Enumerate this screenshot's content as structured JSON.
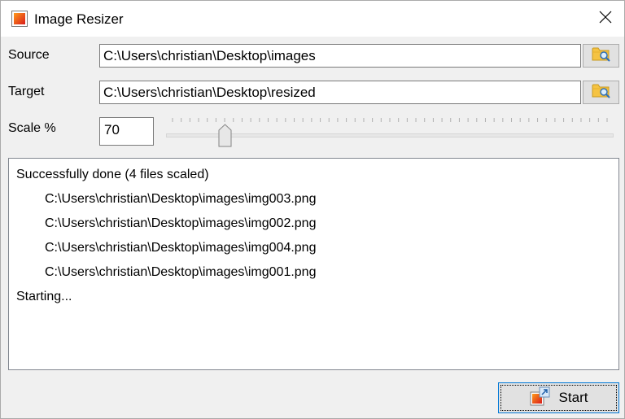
{
  "window": {
    "title": "Image Resizer",
    "icons": {
      "app": "image-resizer-app-icon",
      "close": "close-icon"
    }
  },
  "source": {
    "label": "Source",
    "value": "C:\\Users\\christian\\Desktop\\images",
    "browse_icon": "folder-search-icon"
  },
  "target": {
    "label": "Target",
    "value": "C:\\Users\\christian\\Desktop\\resized",
    "browse_icon": "folder-search-icon"
  },
  "scale": {
    "label": "Scale %",
    "value": "70",
    "slider_level_fraction": 0.12
  },
  "log": {
    "summary": "Successfully done (4 files scaled)",
    "files": [
      "C:\\Users\\christian\\Desktop\\images\\img003.png",
      "C:\\Users\\christian\\Desktop\\images\\img002.png",
      "C:\\Users\\christian\\Desktop\\images\\img004.png",
      "C:\\Users\\christian\\Desktop\\images\\img001.png"
    ],
    "start_message": "Starting..."
  },
  "start_button": {
    "label": "Start",
    "icon": "resize-image-icon"
  },
  "colors": {
    "window_bg": "#f0f0f0",
    "titlebar_bg": "#ffffff",
    "focus_border": "#0078d7"
  }
}
